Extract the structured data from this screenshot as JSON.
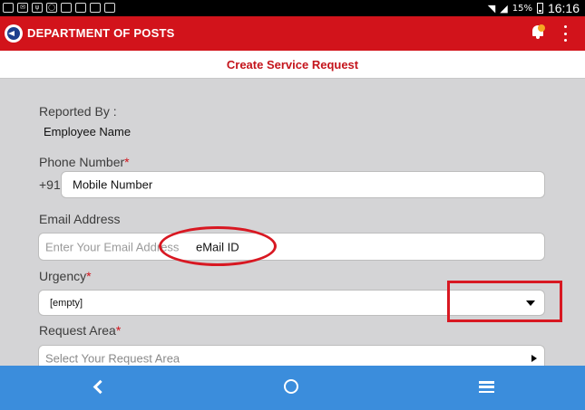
{
  "status_bar": {
    "notification_icons": [
      "sim-icon",
      "mail-icon",
      "usb-icon",
      "whatsapp-icon",
      "app-icon",
      "gallery-icon",
      "gallery-icon",
      "gallery-icon"
    ],
    "battery": "15%",
    "time": "16:16"
  },
  "app_bar": {
    "title": "DEPARTMENT OF POSTS"
  },
  "page": {
    "title": "Create Service Request"
  },
  "form": {
    "reported_by": {
      "label": "Reported By :",
      "value": "Employee Name"
    },
    "phone": {
      "label": "Phone Number",
      "required_mark": "*",
      "prefix": "+91",
      "value": "Mobile Number"
    },
    "email": {
      "label": "Email Address",
      "placeholder": "Enter Your Email Address",
      "value": "eMail ID"
    },
    "urgency": {
      "label": "Urgency",
      "required_mark": "*",
      "selected": "[empty]"
    },
    "request_area": {
      "label": "Request Area",
      "required_mark": "*",
      "placeholder": "Select Your Request Area"
    }
  },
  "colors": {
    "brand_red": "#d2131b",
    "nav_blue": "#3b8ddc",
    "annotation_red": "#d81822",
    "background": "#d4d4d6"
  }
}
